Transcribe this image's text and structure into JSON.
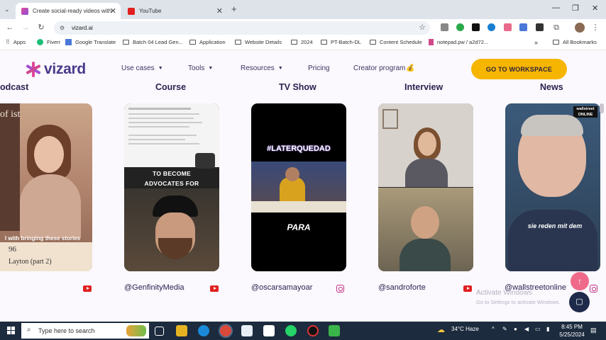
{
  "browser": {
    "tabs": [
      {
        "title": "Create social-ready videos with",
        "active": true
      },
      {
        "title": "YouTube",
        "active": false
      }
    ],
    "new_tab": "+",
    "url": "vizard.ai",
    "bookmarks": [
      "Apps",
      "Fiverr",
      "Google Translate",
      "Batch 04 Lead Gen...",
      "Application",
      "Website Details",
      "2024",
      "PT-Batch-DL",
      "Content Schedule",
      "notepad.pw / a2d72...",
      "All Bookmarks"
    ],
    "more_bookmarks": "»"
  },
  "site": {
    "logo": "vizard",
    "nav": [
      "Use cases",
      "Tools",
      "Resources",
      "Pricing",
      "Creator program"
    ],
    "creator_emoji": "💰",
    "cta": "GO TO WORKSPACE",
    "categories": [
      "odcast",
      "Course",
      "TV Show",
      "Interview",
      "News"
    ],
    "cards": [
      {
        "caption_lines": [
          "l with bringing these stories",
          "96",
          "Layton (part 2)"
        ],
        "book_text": "of ist"
      },
      {
        "caption_lines": [
          "TO BECOME",
          "ADVOCATES FOR"
        ]
      },
      {
        "caption_lines": [
          "#LATERQUEDAD",
          "PARA"
        ]
      },
      {
        "caption_lines": []
      },
      {
        "caption_lines": [
          "sie reden mit dem"
        ],
        "badge": "wallstreet ONLINE"
      }
    ],
    "handles": [
      "@GenfinityMedia",
      "@oscarsamayoar",
      "@sandroforte",
      "@wallstreetonline"
    ]
  },
  "overlay": {
    "activate_title": "Activate Windows",
    "activate_sub": "Go to Settings to activate Windows."
  },
  "taskbar": {
    "search_placeholder": "Type here to search",
    "weather": "34°C  Haze",
    "time": "8:45 PM",
    "date": "5/25/2024"
  },
  "colors": {
    "accent": "#f5b500",
    "brand": "#4a3a8a",
    "tab_strip": "#dee3ea"
  }
}
